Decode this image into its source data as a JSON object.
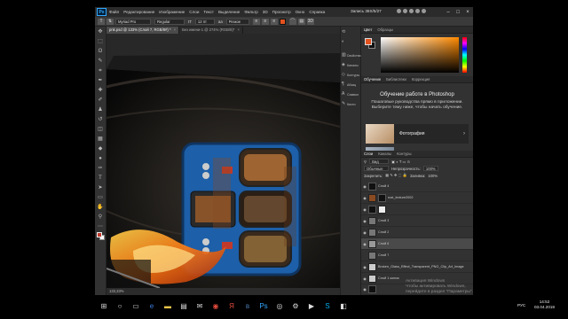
{
  "app": {
    "logo": "Ps",
    "menu": [
      "Файл",
      "Редактирование",
      "Изображение",
      "Слои",
      "Текст",
      "Выделение",
      "Фильтр",
      "3D",
      "Просмотр",
      "Окно",
      "Справка"
    ],
    "window_title": "Запись 38Х/5/27"
  },
  "options": {
    "font": "Myriad Pro",
    "style": "Regular",
    "size": "12 пт",
    "aa": "Резкое",
    "color": "#e4521f"
  },
  "tabs": [
    {
      "label": "pnk.psd @ 133% (Слой 7, RGB/8#) *",
      "active": true
    },
    {
      "label": "Без имени-1 @ 274% (RGB/8)*",
      "active": false
    }
  ],
  "canvas": {
    "zoom": "133,33%"
  },
  "dock": [
    {
      "icon": "history-icon",
      "label": ""
    },
    {
      "icon": "adjust-icon",
      "label": ""
    },
    {
      "icon": "brush-icon",
      "label": "Свойства"
    },
    {
      "icon": "channels-icon",
      "label": "Каналы"
    },
    {
      "icon": "paths-icon",
      "label": "Контуры"
    },
    {
      "icon": "char-icon",
      "label": "Абзац"
    },
    {
      "icon": "glyph-icon",
      "label": "Символ"
    },
    {
      "icon": "swatch-icon",
      "label": "Кисти"
    }
  ],
  "color_panel": {
    "tabs": [
      "Цвет",
      "Образцы"
    ],
    "fg": "#e4521f",
    "bg": "#111111"
  },
  "learn": {
    "tabs": [
      "Обучение",
      "Библиотеки",
      "Коррекция"
    ],
    "heading": "Обучение работе в Photoshop",
    "text": "Пошаговые руководства прямо в приложении. Выберите тему ниже, чтобы начать обучение.",
    "card": "Фотография"
  },
  "layers_panel": {
    "tabs": [
      "Слои",
      "Каналы",
      "Контуры"
    ],
    "blend": "Обычные",
    "opacity_label": "Непрозрачность:",
    "opacity": "100%",
    "lock_label": "Закрепить:",
    "fill_label": "Заливка:",
    "fill": "100%",
    "layers": [
      {
        "name": "Слой 4",
        "dark": false,
        "sel": false
      },
      {
        "name": "rust_texture2002",
        "dark": true,
        "sel": false
      },
      {
        "name": "",
        "dark": true,
        "sel": false
      },
      {
        "name": "Слой 3",
        "dark": false,
        "sel": false
      },
      {
        "name": "Слой 2",
        "dark": false,
        "sel": false
      },
      {
        "name": "Слой 6",
        "dark": false,
        "sel": true
      },
      {
        "name": "Слой 7",
        "dark": false,
        "sel": false
      },
      {
        "name": "Broken_Glass_Effect_Transparent_PNG_Clip_Art_Image",
        "dark": false,
        "sel": false
      },
      {
        "name": "Слой 1 копия",
        "dark": false,
        "sel": false
      }
    ],
    "watermark": [
      "Активация Windows",
      "Чтобы активировать Windows, перейдите в раздел \"Параметры\"."
    ]
  },
  "taskbar": {
    "lang": "РУС",
    "time": "14:52",
    "date": "03.04.2019",
    "icons": [
      "windows-icon",
      "search-icon",
      "taskview-icon",
      "edge-icon",
      "explorer-icon",
      "store-icon",
      "mail-icon",
      "chrome-icon",
      "yandex-icon",
      "vk-icon",
      "photoshop-icon",
      "obs-icon",
      "settings-icon",
      "player-icon",
      "skype-icon",
      "app-icon"
    ]
  }
}
